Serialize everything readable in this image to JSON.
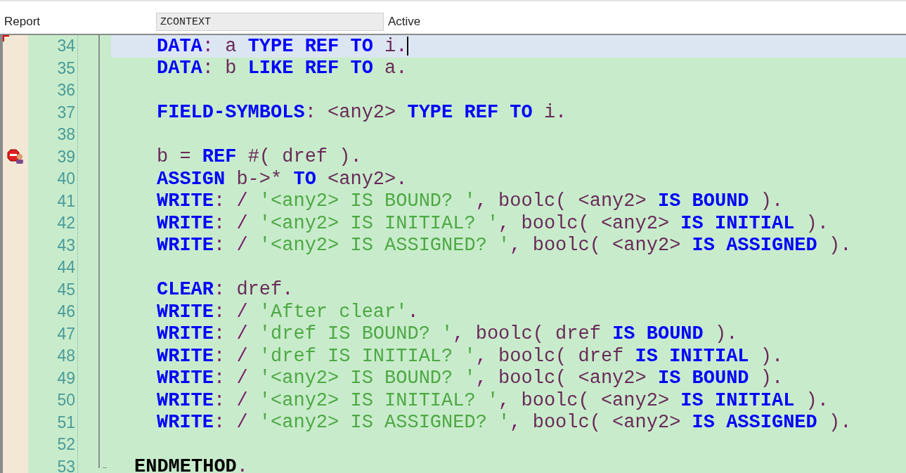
{
  "header": {
    "object_type_label": "Report",
    "object_name": "ZCONTEXT",
    "status": "Active"
  },
  "editor": {
    "lines": [
      {
        "number": "34",
        "kind": "body",
        "current": true,
        "breakpoint": false,
        "tokens": [
          {
            "kind": "keyword",
            "text": "DATA"
          },
          {
            "kind": "punct",
            "text": ": "
          },
          {
            "kind": "ident",
            "text": "a "
          },
          {
            "kind": "keyword",
            "text": "TYPE REF TO "
          },
          {
            "kind": "ident",
            "text": "i"
          },
          {
            "kind": "punct",
            "text": "."
          }
        ]
      },
      {
        "number": "35",
        "kind": "body",
        "current": false,
        "breakpoint": false,
        "tokens": [
          {
            "kind": "keyword",
            "text": "DATA"
          },
          {
            "kind": "punct",
            "text": ": "
          },
          {
            "kind": "ident",
            "text": "b "
          },
          {
            "kind": "keyword",
            "text": "LIKE REF TO "
          },
          {
            "kind": "ident",
            "text": "a"
          },
          {
            "kind": "punct",
            "text": "."
          }
        ]
      },
      {
        "number": "36",
        "kind": "body",
        "current": false,
        "breakpoint": false
      },
      {
        "number": "37",
        "kind": "body",
        "current": false,
        "breakpoint": false,
        "tokens": [
          {
            "kind": "keyword",
            "text": "FIELD-SYMBOLS"
          },
          {
            "kind": "punct",
            "text": ": "
          },
          {
            "kind": "ident",
            "text": "<any2> "
          },
          {
            "kind": "keyword",
            "text": "TYPE REF TO "
          },
          {
            "kind": "ident",
            "text": "i"
          },
          {
            "kind": "punct",
            "text": "."
          }
        ]
      },
      {
        "number": "38",
        "kind": "body",
        "current": false,
        "breakpoint": false
      },
      {
        "number": "39",
        "kind": "body",
        "current": false,
        "breakpoint": true,
        "tokens": [
          {
            "kind": "ident",
            "text": "b = "
          },
          {
            "kind": "keyword",
            "text": "REF "
          },
          {
            "kind": "ident",
            "text": "#( dref )"
          },
          {
            "kind": "punct",
            "text": "."
          }
        ]
      },
      {
        "number": "40",
        "kind": "body",
        "current": false,
        "breakpoint": false,
        "tokens": [
          {
            "kind": "keyword",
            "text": "ASSIGN "
          },
          {
            "kind": "ident",
            "text": "b->* "
          },
          {
            "kind": "keyword",
            "text": "TO "
          },
          {
            "kind": "ident",
            "text": "<any2>"
          },
          {
            "kind": "punct",
            "text": "."
          }
        ]
      },
      {
        "number": "41",
        "kind": "body",
        "current": false,
        "breakpoint": false,
        "tokens": [
          {
            "kind": "keyword",
            "text": "WRITE"
          },
          {
            "kind": "punct",
            "text": ": / "
          },
          {
            "kind": "string",
            "text": "'<any2> IS BOUND? '"
          },
          {
            "kind": "punct",
            "text": ", "
          },
          {
            "kind": "ident",
            "text": "boolc( <any2> "
          },
          {
            "kind": "keyword",
            "text": "IS BOUND "
          },
          {
            "kind": "ident",
            "text": ")"
          },
          {
            "kind": "punct",
            "text": "."
          }
        ]
      },
      {
        "number": "42",
        "kind": "body",
        "current": false,
        "breakpoint": false,
        "tokens": [
          {
            "kind": "keyword",
            "text": "WRITE"
          },
          {
            "kind": "punct",
            "text": ": / "
          },
          {
            "kind": "string",
            "text": "'<any2> IS INITIAL? '"
          },
          {
            "kind": "punct",
            "text": ", "
          },
          {
            "kind": "ident",
            "text": "boolc( <any2> "
          },
          {
            "kind": "keyword",
            "text": "IS INITIAL "
          },
          {
            "kind": "ident",
            "text": ")"
          },
          {
            "kind": "punct",
            "text": "."
          }
        ]
      },
      {
        "number": "43",
        "kind": "body",
        "current": false,
        "breakpoint": false,
        "tokens": [
          {
            "kind": "keyword",
            "text": "WRITE"
          },
          {
            "kind": "punct",
            "text": ": / "
          },
          {
            "kind": "string",
            "text": "'<any2> IS ASSIGNED? '"
          },
          {
            "kind": "punct",
            "text": ", "
          },
          {
            "kind": "ident",
            "text": "boolc( <any2> "
          },
          {
            "kind": "keyword",
            "text": "IS ASSIGNED "
          },
          {
            "kind": "ident",
            "text": ")"
          },
          {
            "kind": "punct",
            "text": "."
          }
        ]
      },
      {
        "number": "44",
        "kind": "body",
        "current": false,
        "breakpoint": false
      },
      {
        "number": "45",
        "kind": "body",
        "current": false,
        "breakpoint": false,
        "tokens": [
          {
            "kind": "keyword",
            "text": "CLEAR"
          },
          {
            "kind": "punct",
            "text": ": "
          },
          {
            "kind": "ident",
            "text": "dref"
          },
          {
            "kind": "punct",
            "text": "."
          }
        ]
      },
      {
        "number": "46",
        "kind": "body",
        "current": false,
        "breakpoint": false,
        "tokens": [
          {
            "kind": "keyword",
            "text": "WRITE"
          },
          {
            "kind": "punct",
            "text": ": / "
          },
          {
            "kind": "string",
            "text": "'After clear'"
          },
          {
            "kind": "punct",
            "text": "."
          }
        ]
      },
      {
        "number": "47",
        "kind": "body",
        "current": false,
        "breakpoint": false,
        "tokens": [
          {
            "kind": "keyword",
            "text": "WRITE"
          },
          {
            "kind": "punct",
            "text": ": / "
          },
          {
            "kind": "string",
            "text": "'dref IS BOUND? '"
          },
          {
            "kind": "punct",
            "text": ", "
          },
          {
            "kind": "ident",
            "text": "boolc( dref "
          },
          {
            "kind": "keyword",
            "text": "IS BOUND "
          },
          {
            "kind": "ident",
            "text": ")"
          },
          {
            "kind": "punct",
            "text": "."
          }
        ]
      },
      {
        "number": "48",
        "kind": "body",
        "current": false,
        "breakpoint": false,
        "tokens": [
          {
            "kind": "keyword",
            "text": "WRITE"
          },
          {
            "kind": "punct",
            "text": ": / "
          },
          {
            "kind": "string",
            "text": "'dref IS INITIAL? '"
          },
          {
            "kind": "punct",
            "text": ", "
          },
          {
            "kind": "ident",
            "text": "boolc( dref "
          },
          {
            "kind": "keyword",
            "text": "IS INITIAL "
          },
          {
            "kind": "ident",
            "text": ")"
          },
          {
            "kind": "punct",
            "text": "."
          }
        ]
      },
      {
        "number": "49",
        "kind": "body",
        "current": false,
        "breakpoint": false,
        "tokens": [
          {
            "kind": "keyword",
            "text": "WRITE"
          },
          {
            "kind": "punct",
            "text": ": / "
          },
          {
            "kind": "string",
            "text": "'<any2> IS BOUND? '"
          },
          {
            "kind": "punct",
            "text": ", "
          },
          {
            "kind": "ident",
            "text": "boolc( <any2> "
          },
          {
            "kind": "keyword",
            "text": "IS BOUND "
          },
          {
            "kind": "ident",
            "text": ")"
          },
          {
            "kind": "punct",
            "text": "."
          }
        ]
      },
      {
        "number": "50",
        "kind": "body",
        "current": false,
        "breakpoint": false,
        "tokens": [
          {
            "kind": "keyword",
            "text": "WRITE"
          },
          {
            "kind": "punct",
            "text": ": / "
          },
          {
            "kind": "string",
            "text": "'<any2> IS INITIAL? '"
          },
          {
            "kind": "punct",
            "text": ", "
          },
          {
            "kind": "ident",
            "text": "boolc( <any2> "
          },
          {
            "kind": "keyword",
            "text": "IS INITIAL "
          },
          {
            "kind": "ident",
            "text": ")"
          },
          {
            "kind": "punct",
            "text": "."
          }
        ]
      },
      {
        "number": "51",
        "kind": "body",
        "current": false,
        "breakpoint": false,
        "tokens": [
          {
            "kind": "keyword",
            "text": "WRITE"
          },
          {
            "kind": "punct",
            "text": ": / "
          },
          {
            "kind": "string",
            "text": "'<any2> IS ASSIGNED? '"
          },
          {
            "kind": "punct",
            "text": ", "
          },
          {
            "kind": "ident",
            "text": "boolc( <any2> "
          },
          {
            "kind": "keyword",
            "text": "IS ASSIGNED "
          },
          {
            "kind": "ident",
            "text": ")"
          },
          {
            "kind": "punct",
            "text": "."
          }
        ]
      },
      {
        "number": "52",
        "kind": "body",
        "current": false,
        "breakpoint": false
      },
      {
        "number": "53",
        "kind": "closing",
        "current": false,
        "breakpoint": false,
        "tokens": [
          {
            "kind": "endkeyword",
            "text": "ENDMETHOD"
          },
          {
            "kind": "punct",
            "text": "."
          }
        ]
      }
    ]
  }
}
